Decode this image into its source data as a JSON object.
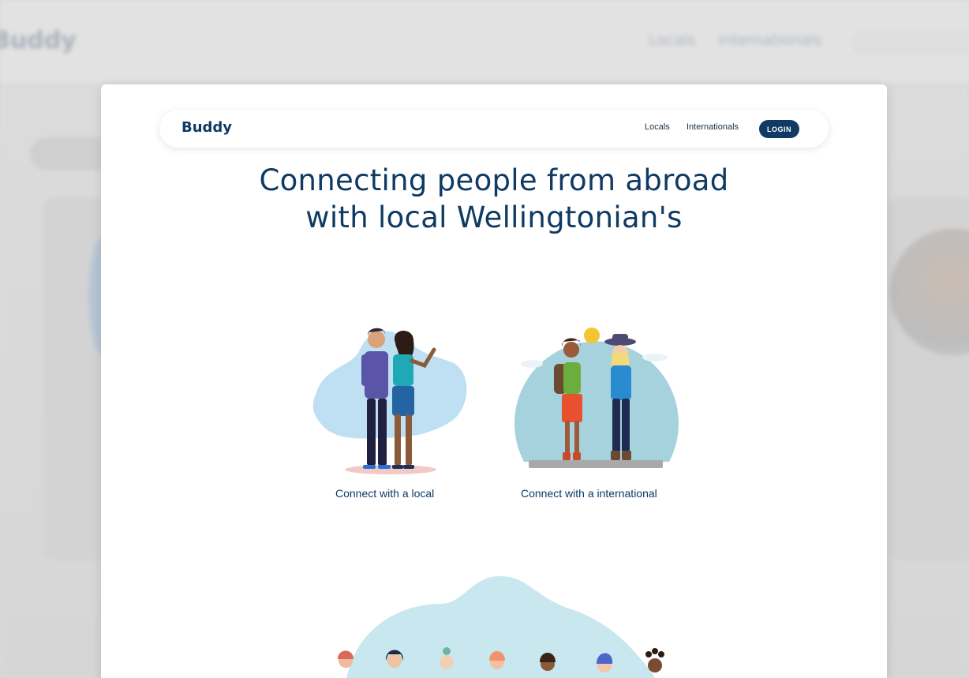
{
  "background": {
    "logo": "Buddy",
    "links": [
      "Locals",
      "Internationals"
    ]
  },
  "navbar": {
    "brand": "Buddy",
    "links": [
      "Locals",
      "Internationals"
    ],
    "login_label": "LOGIN"
  },
  "hero": {
    "line1": "Connecting people from abroad",
    "line2": "with local Wellingtonian's"
  },
  "options": [
    {
      "label": "Connect with a local",
      "illustration": "couple-illustration"
    },
    {
      "label": "Connect with a international",
      "illustration": "travellers-illustration"
    }
  ],
  "colors": {
    "primary": "#0f3a64",
    "blob": "#bfe0f2",
    "circle": "#a6d2de"
  }
}
